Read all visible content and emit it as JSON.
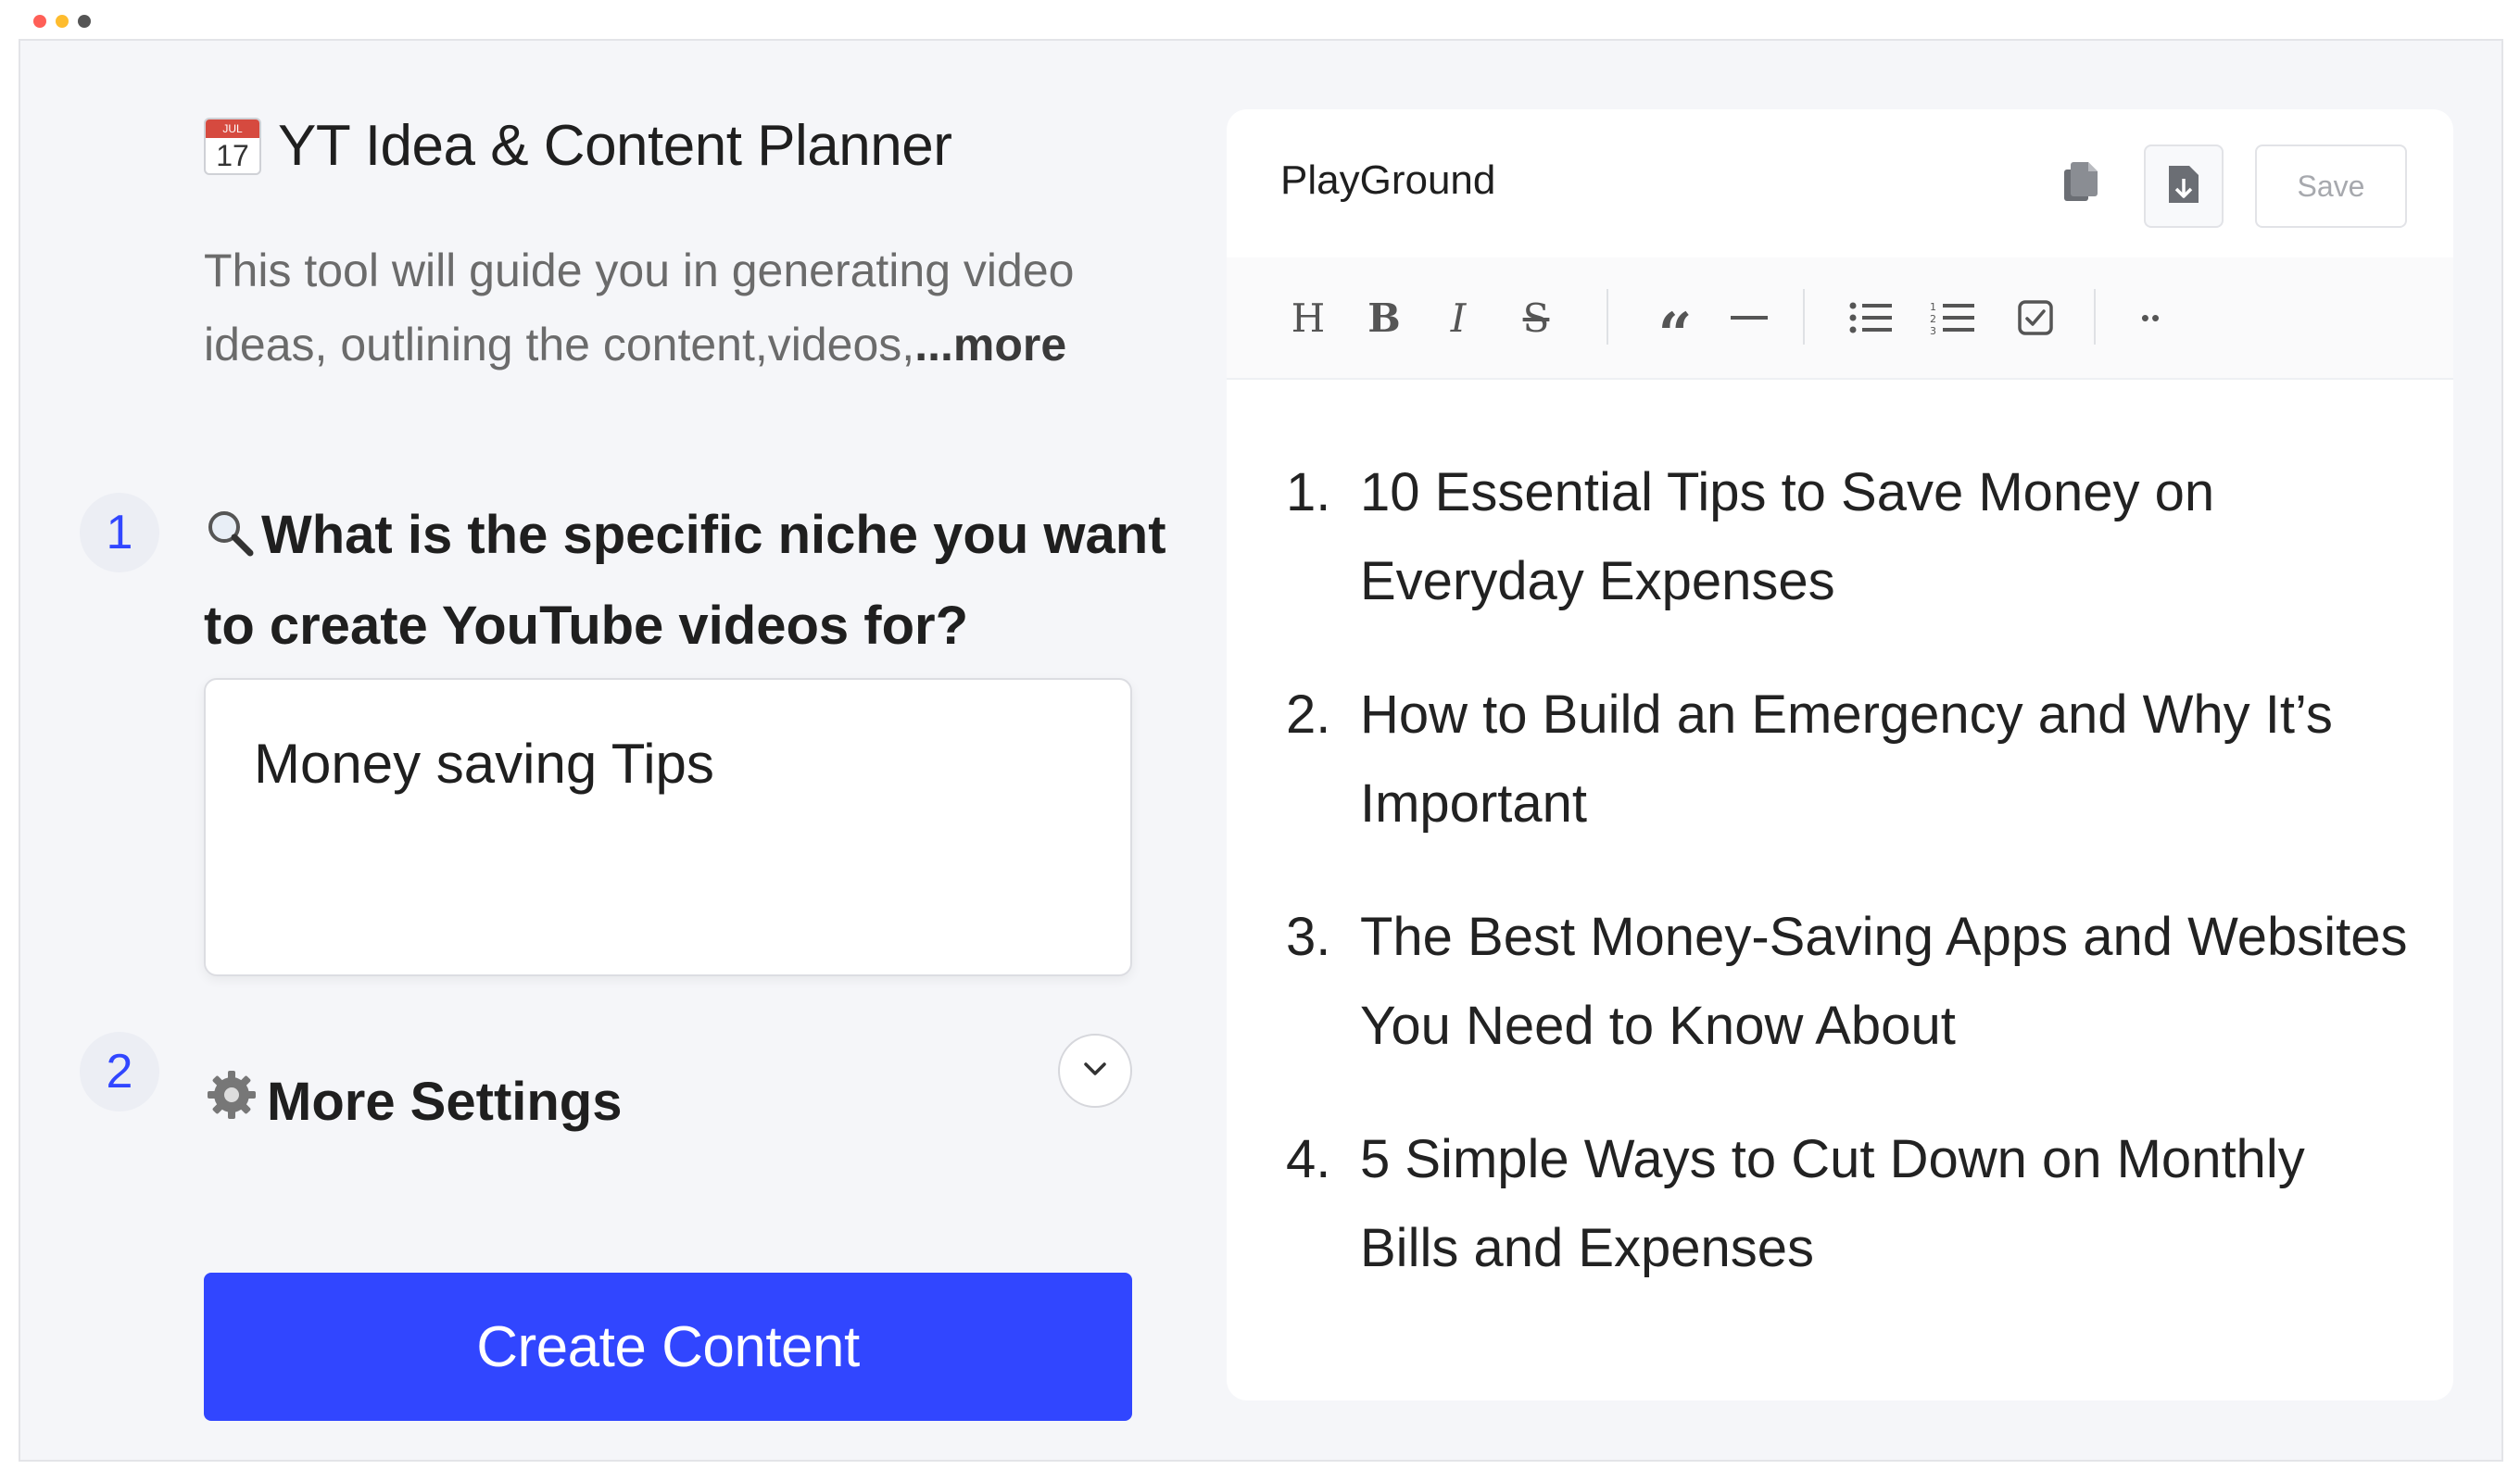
{
  "window": {
    "dot_colors": [
      "#ff5f57",
      "#febc2e",
      "#555555"
    ]
  },
  "app": {
    "title": "YT Idea & Content Planner",
    "icon": "calendar-icon",
    "calendar_month": "JUL",
    "calendar_day": "17",
    "description": "This tool will guide you in generating video ideas, outlining the content,videos,",
    "more_label": "...more"
  },
  "steps": [
    {
      "number": "1",
      "icon": "magnifier-icon",
      "question": "What is the specific niche you want to create YouTube videos for?",
      "input_value": "Money saving Tips"
    },
    {
      "number": "2",
      "icon": "gear-icon",
      "label": "More Settings"
    }
  ],
  "create_button": "Create Content",
  "colors": {
    "accent": "#3146ff",
    "panel_bg": "#f5f6f9"
  },
  "playground": {
    "title": "PlayGround",
    "save_label": "Save",
    "toolbar_icons": [
      "heading-icon",
      "bold-icon",
      "italic-icon",
      "strikethrough-icon",
      "quote-icon",
      "horizontal-rule-icon",
      "bullet-list-icon",
      "ordered-list-icon",
      "checkbox-icon",
      "more-icon"
    ],
    "toolbar_labels": {
      "heading": "H",
      "bold": "B",
      "italic": "I",
      "strike": "S",
      "quote": "“",
      "more": "••"
    },
    "items": [
      {
        "num": "1.",
        "text": "10 Essential Tips to Save Money on Everyday Expenses"
      },
      {
        "num": "2.",
        "text": "How to Build an Emergency and Why It’s Important"
      },
      {
        "num": "3.",
        "text": "The Best Money-Saving Apps and Websites You Need to Know About"
      },
      {
        "num": "4.",
        "text": "5 Simple Ways to Cut Down on Monthly Bills and Expenses"
      }
    ]
  }
}
